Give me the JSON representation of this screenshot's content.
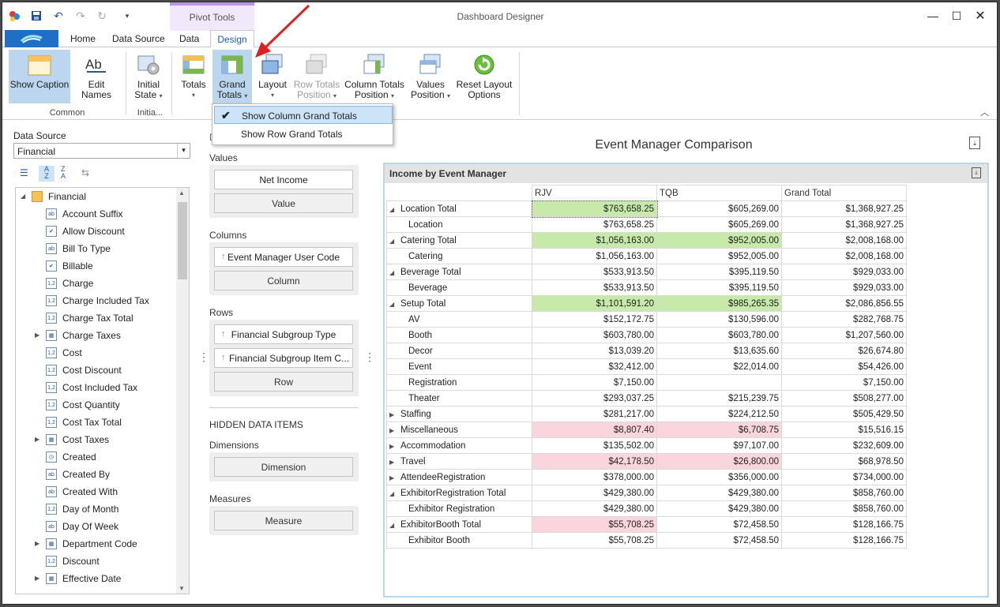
{
  "window": {
    "title": "Dashboard Designer",
    "context_tab_group": "Pivot Tools"
  },
  "tabs": [
    {
      "label": "Home"
    },
    {
      "label": "Data Source"
    },
    {
      "label": "Data"
    },
    {
      "label": "Design"
    }
  ],
  "ribbon": {
    "show_caption": "Show Caption",
    "edit_names": "Edit Names",
    "initial_state_1": "Initial",
    "initial_state_2": "State",
    "totals": "Totals",
    "grand_totals_1": "Grand",
    "grand_totals_2": "Totals",
    "layout": "Layout",
    "row_totals_1": "Row Totals",
    "row_totals_2": "Position",
    "column_totals_1": "Column Totals",
    "column_totals_2": "Position",
    "values_position_1": "Values",
    "values_position_2": "Position",
    "reset_layout_1": "Reset Layout",
    "reset_layout_2": "Options",
    "group_common": "Common",
    "group_initial": "Initia..."
  },
  "dropdown": {
    "items": [
      {
        "label": "Show Column Grand Totals",
        "checked": true
      },
      {
        "label": "Show Row Grand Totals",
        "checked": false
      }
    ]
  },
  "data_source": {
    "label": "Data Source",
    "value": "Financial",
    "root": "Financial",
    "fields": [
      {
        "label": "Account Suffix",
        "icon": "text-field-icon"
      },
      {
        "label": "Allow Discount",
        "icon": "checkbox-field-icon"
      },
      {
        "label": "Bill To Type",
        "icon": "text-field-icon"
      },
      {
        "label": "Billable",
        "icon": "checkbox-field-icon"
      },
      {
        "label": "Charge",
        "icon": "number-field-icon"
      },
      {
        "label": "Charge Included Tax",
        "icon": "number-field-icon"
      },
      {
        "label": "Charge Tax Total",
        "icon": "number-field-icon"
      },
      {
        "label": "Charge Taxes",
        "icon": "table-field-icon"
      },
      {
        "label": "Cost",
        "icon": "number-field-icon"
      },
      {
        "label": "Cost Discount",
        "icon": "number-field-icon"
      },
      {
        "label": "Cost Included Tax",
        "icon": "number-field-icon"
      },
      {
        "label": "Cost Quantity",
        "icon": "number-field-icon"
      },
      {
        "label": "Cost Tax Total",
        "icon": "number-field-icon"
      },
      {
        "label": "Cost Taxes",
        "icon": "table-field-icon"
      },
      {
        "label": "Created",
        "icon": "clock-field-icon"
      },
      {
        "label": "Created By",
        "icon": "text-field-icon"
      },
      {
        "label": "Created With",
        "icon": "text-field-icon"
      },
      {
        "label": "Day of Month",
        "icon": "number-field-icon"
      },
      {
        "label": "Day Of Week",
        "icon": "text-field-icon"
      },
      {
        "label": "Department Code",
        "icon": "table-field-icon"
      },
      {
        "label": "Discount",
        "icon": "number-field-icon"
      },
      {
        "label": "Effective Date",
        "icon": "table-field-icon"
      }
    ]
  },
  "data_items": {
    "values_label": "Values",
    "values_item": "Net Income",
    "values_placeholder": "Value",
    "columns_label": "Columns",
    "columns_item": "Event Manager User Code",
    "columns_placeholder": "Column",
    "rows_label": "Rows",
    "rows_item_1": "Financial Subgroup Type",
    "rows_item_2": "Financial Subgroup Item C...",
    "rows_placeholder": "Row",
    "hidden_label": "HIDDEN DATA ITEMS",
    "dimensions_label": "Dimensions",
    "dimensions_placeholder": "Dimension",
    "measures_label": "Measures",
    "measures_placeholder": "Measure"
  },
  "dashboard": {
    "title": "Event Manager Comparison",
    "pivot_caption": "Income by Event Manager",
    "columns": [
      "RJV",
      "TQB",
      "Grand Total"
    ],
    "rows": [
      {
        "label": "Location Total",
        "expander": "collapse",
        "level": 0,
        "values": [
          "$763,658.25",
          "$605,269.00",
          "$1,368,927.25"
        ],
        "hl": [
          "green",
          "",
          ""
        ]
      },
      {
        "label": "Location",
        "level": 1,
        "values": [
          "$763,658.25",
          "$605,269.00",
          "$1,368,927.25"
        ],
        "hl": [
          "",
          "",
          ""
        ]
      },
      {
        "label": "Catering Total",
        "expander": "collapse",
        "level": 0,
        "values": [
          "$1,056,163.00",
          "$952,005.00",
          "$2,008,168.00"
        ],
        "hl": [
          "green",
          "green",
          ""
        ]
      },
      {
        "label": "Catering",
        "level": 1,
        "values": [
          "$1,056,163.00",
          "$952,005.00",
          "$2,008,168.00"
        ],
        "hl": [
          "",
          "",
          ""
        ]
      },
      {
        "label": "Beverage Total",
        "expander": "collapse",
        "level": 0,
        "values": [
          "$533,913.50",
          "$395,119.50",
          "$929,033.00"
        ],
        "hl": [
          "",
          "",
          ""
        ]
      },
      {
        "label": "Beverage",
        "level": 1,
        "values": [
          "$533,913.50",
          "$395,119.50",
          "$929,033.00"
        ],
        "hl": [
          "",
          "",
          ""
        ]
      },
      {
        "label": "Setup Total",
        "expander": "collapse",
        "level": 0,
        "values": [
          "$1,101,591.20",
          "$985,265.35",
          "$2,086,856.55"
        ],
        "hl": [
          "green",
          "green",
          ""
        ]
      },
      {
        "label": "AV",
        "level": 1,
        "values": [
          "$152,172.75",
          "$130,596.00",
          "$282,768.75"
        ],
        "hl": [
          "",
          "",
          ""
        ]
      },
      {
        "label": "Booth",
        "level": 1,
        "values": [
          "$603,780.00",
          "$603,780.00",
          "$1,207,560.00"
        ],
        "hl": [
          "",
          "",
          ""
        ]
      },
      {
        "label": "Decor",
        "level": 1,
        "values": [
          "$13,039.20",
          "$13,635.60",
          "$26,674.80"
        ],
        "hl": [
          "",
          "",
          ""
        ]
      },
      {
        "label": "Event",
        "level": 1,
        "values": [
          "$32,412.00",
          "$22,014.00",
          "$54,426.00"
        ],
        "hl": [
          "",
          "",
          ""
        ]
      },
      {
        "label": "Registration",
        "level": 1,
        "values": [
          "$7,150.00",
          "",
          "$7,150.00"
        ],
        "hl": [
          "",
          "",
          ""
        ]
      },
      {
        "label": "Theater",
        "level": 1,
        "values": [
          "$293,037.25",
          "$215,239.75",
          "$508,277.00"
        ],
        "hl": [
          "",
          "",
          ""
        ]
      },
      {
        "label": "Staffing",
        "expander": "expand",
        "level": 0,
        "values": [
          "$281,217.00",
          "$224,212.50",
          "$505,429.50"
        ],
        "hl": [
          "",
          "",
          ""
        ]
      },
      {
        "label": "Miscellaneous",
        "expander": "expand",
        "level": 0,
        "values": [
          "$8,807.40",
          "$6,708.75",
          "$15,516.15"
        ],
        "hl": [
          "red",
          "red",
          ""
        ]
      },
      {
        "label": "Accommodation",
        "expander": "expand",
        "level": 0,
        "values": [
          "$135,502.00",
          "$97,107.00",
          "$232,609.00"
        ],
        "hl": [
          "",
          "",
          ""
        ]
      },
      {
        "label": "Travel",
        "expander": "expand",
        "level": 0,
        "values": [
          "$42,178.50",
          "$26,800.00",
          "$68,978.50"
        ],
        "hl": [
          "red",
          "red",
          ""
        ]
      },
      {
        "label": "AttendeeRegistration",
        "expander": "expand",
        "level": 0,
        "values": [
          "$378,000.00",
          "$356,000.00",
          "$734,000.00"
        ],
        "hl": [
          "",
          "",
          ""
        ]
      },
      {
        "label": "ExhibitorRegistration Total",
        "expander": "collapse",
        "level": 0,
        "values": [
          "$429,380.00",
          "$429,380.00",
          "$858,760.00"
        ],
        "hl": [
          "",
          "",
          ""
        ]
      },
      {
        "label": "Exhibitor Registration",
        "level": 1,
        "values": [
          "$429,380.00",
          "$429,380.00",
          "$858,760.00"
        ],
        "hl": [
          "",
          "",
          ""
        ]
      },
      {
        "label": "ExhibitorBooth Total",
        "expander": "collapse",
        "level": 0,
        "values": [
          "$55,708.25",
          "$72,458.50",
          "$128,166.75"
        ],
        "hl": [
          "red",
          "",
          ""
        ]
      },
      {
        "label": "Exhibitor Booth",
        "level": 1,
        "values": [
          "$55,708.25",
          "$72,458.50",
          "$128,166.75"
        ],
        "hl": [
          "",
          "",
          ""
        ]
      }
    ]
  },
  "colors": {
    "highlight_green": "#c7e9a9",
    "highlight_red": "#fbd5dd",
    "accent": "#1e6fc5",
    "annotation_arrow": "#e02020"
  }
}
